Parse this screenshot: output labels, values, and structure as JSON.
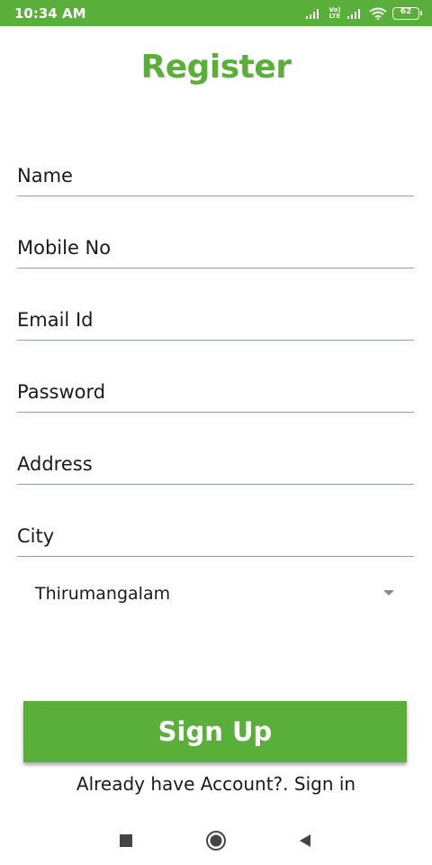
{
  "status_bar": {
    "time": "10:34 AM",
    "network_label": "Vo) LTE",
    "battery_level": "62",
    "background_color": "#5aae3a",
    "icons": [
      "signal-icon",
      "volte-icon",
      "signal-icon",
      "wifi-icon",
      "battery-icon"
    ]
  },
  "page": {
    "title": "Register",
    "accent_color": "#5aae3a",
    "underline_color": "#3cc2e3"
  },
  "form": {
    "fields": [
      {
        "placeholder": "Name",
        "value": ""
      },
      {
        "placeholder": "Mobile No",
        "value": ""
      },
      {
        "placeholder": "Email Id",
        "value": ""
      },
      {
        "placeholder": "Password",
        "value": ""
      },
      {
        "placeholder": "Address",
        "value": ""
      },
      {
        "placeholder": "City",
        "value": ""
      }
    ],
    "city_dropdown": {
      "selected": "Thirumangalam",
      "icon": "dropdown-arrow-icon"
    },
    "signup_label": "Sign Up",
    "signin_text": "Already have Account?. Sign in"
  },
  "nav_bar": {
    "icons": [
      "recent-apps-icon",
      "home-icon",
      "back-icon"
    ]
  }
}
